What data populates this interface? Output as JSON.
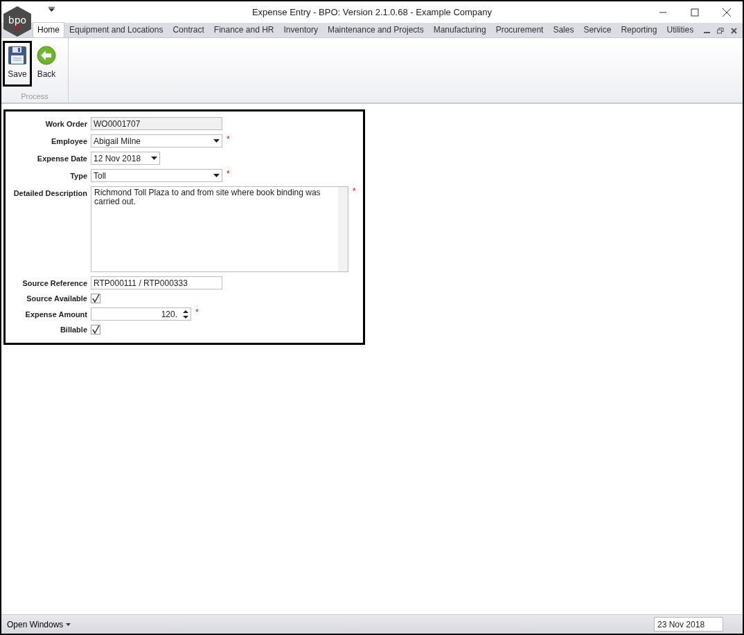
{
  "window": {
    "title": "Expense Entry - BPO: Version 2.1.0.68 - Example Company",
    "logo_text": "bpo"
  },
  "tabs": [
    {
      "label": "Home",
      "selected": true
    },
    {
      "label": "Equipment and Locations",
      "selected": false
    },
    {
      "label": "Contract",
      "selected": false
    },
    {
      "label": "Finance and HR",
      "selected": false
    },
    {
      "label": "Inventory",
      "selected": false
    },
    {
      "label": "Maintenance and Projects",
      "selected": false
    },
    {
      "label": "Manufacturing",
      "selected": false
    },
    {
      "label": "Procurement",
      "selected": false
    },
    {
      "label": "Sales",
      "selected": false
    },
    {
      "label": "Service",
      "selected": false
    },
    {
      "label": "Reporting",
      "selected": false
    },
    {
      "label": "Utilities",
      "selected": false
    }
  ],
  "ribbon": {
    "buttons": [
      {
        "label": "Save",
        "kind": "save",
        "highlighted": true
      },
      {
        "label": "Back",
        "kind": "back",
        "highlighted": false
      }
    ],
    "group_label": "Process"
  },
  "form": {
    "fields": [
      {
        "label": "Work Order",
        "kind": "text",
        "value": "WO0001707",
        "disabled": true
      },
      {
        "label": "Employee",
        "kind": "combo",
        "value": "Abigail Milne",
        "required_mark": "*"
      },
      {
        "label": "Expense Date",
        "kind": "date",
        "value": "12 Nov 2018"
      },
      {
        "label": "Type",
        "kind": "combo",
        "value": "Toll",
        "required_mark": "*"
      },
      {
        "label": "Detailed Description",
        "kind": "memo",
        "value": "Richmond Toll Plaza to and from site where book binding was carried out.",
        "required_mark": "*"
      },
      {
        "label": "Source Reference",
        "kind": "text",
        "value": "RTP000111 / RTP000333",
        "disabled": false
      },
      {
        "label": "Source Available",
        "kind": "checkbox",
        "checked": true
      },
      {
        "label": "Expense Amount",
        "kind": "spin",
        "value": "120.",
        "required_mark": "*"
      },
      {
        "label": "Billable",
        "kind": "checkbox",
        "checked": true
      }
    ]
  },
  "status_bar": {
    "open_windows": "Open Windows",
    "date": "23 Nov 2018"
  }
}
